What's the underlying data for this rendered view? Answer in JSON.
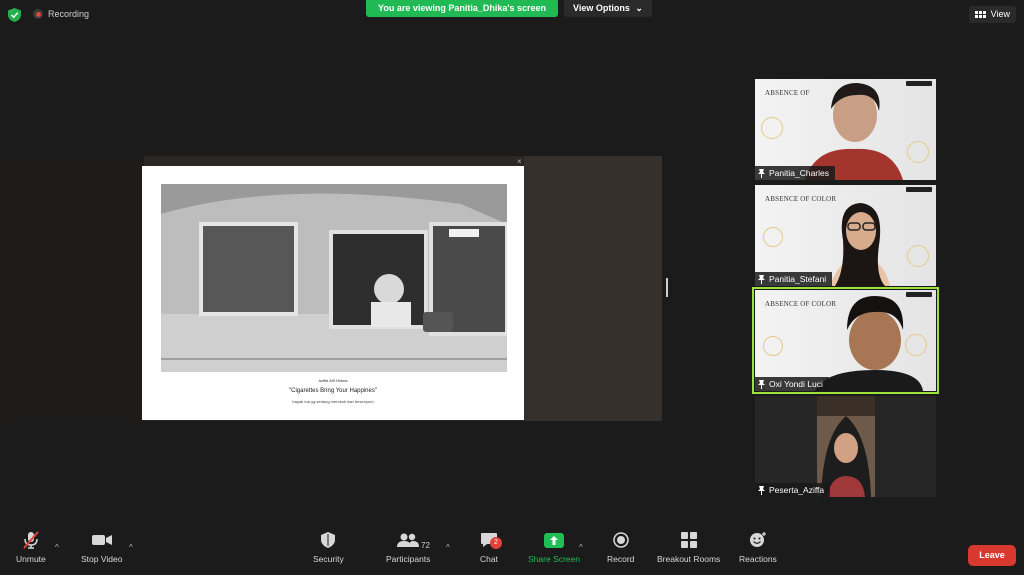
{
  "topbar": {
    "recording_label": "Recording",
    "viewing_banner": "You are viewing Panitia_Dhika's screen",
    "view_options_label": "View Options",
    "view_label": "View"
  },
  "shared_screen": {
    "caption_name": "Aziffa Alif Hidma",
    "caption_title": "\"Cigarettes Bring Your Happines\"",
    "caption_desc": "bapak tua yg sedang merokok dan tersenyum"
  },
  "participants": [
    {
      "name": "Panitia_Charles",
      "slide_text": "ABSENCE OF",
      "active": false
    },
    {
      "name": "Panitia_Stefani",
      "slide_text": "ABSENCE OF COLOR",
      "active": false
    },
    {
      "name": "Oxi Yondi Luci",
      "slide_text": "ABSENCE OF COLOR",
      "active": true
    },
    {
      "name": "Peserta_Aziffa",
      "slide_text": "",
      "active": false
    }
  ],
  "toolbar": {
    "unmute": "Unmute",
    "stop_video": "Stop Video",
    "security": "Security",
    "participants": "Participants",
    "participants_count": "72",
    "chat": "Chat",
    "chat_badge": "2",
    "share_screen": "Share Screen",
    "record": "Record",
    "breakout_rooms": "Breakout Rooms",
    "reactions": "Reactions",
    "leave": "Leave"
  },
  "colors": {
    "banner_green": "#20b954",
    "share_icon_green": "#1fbf55",
    "leave_red": "#d7392f",
    "active_speaker": "#9ee13a"
  },
  "icons": [
    "shield-icon",
    "record-dot-icon",
    "chevron-down-icon",
    "grid-view-icon",
    "pin-icon",
    "mic-muted-icon",
    "video-camera-icon",
    "security-shield-icon",
    "participants-icon",
    "chat-bubble-icon",
    "share-arrow-icon",
    "record-icon",
    "breakout-rooms-icon",
    "reactions-icon"
  ]
}
